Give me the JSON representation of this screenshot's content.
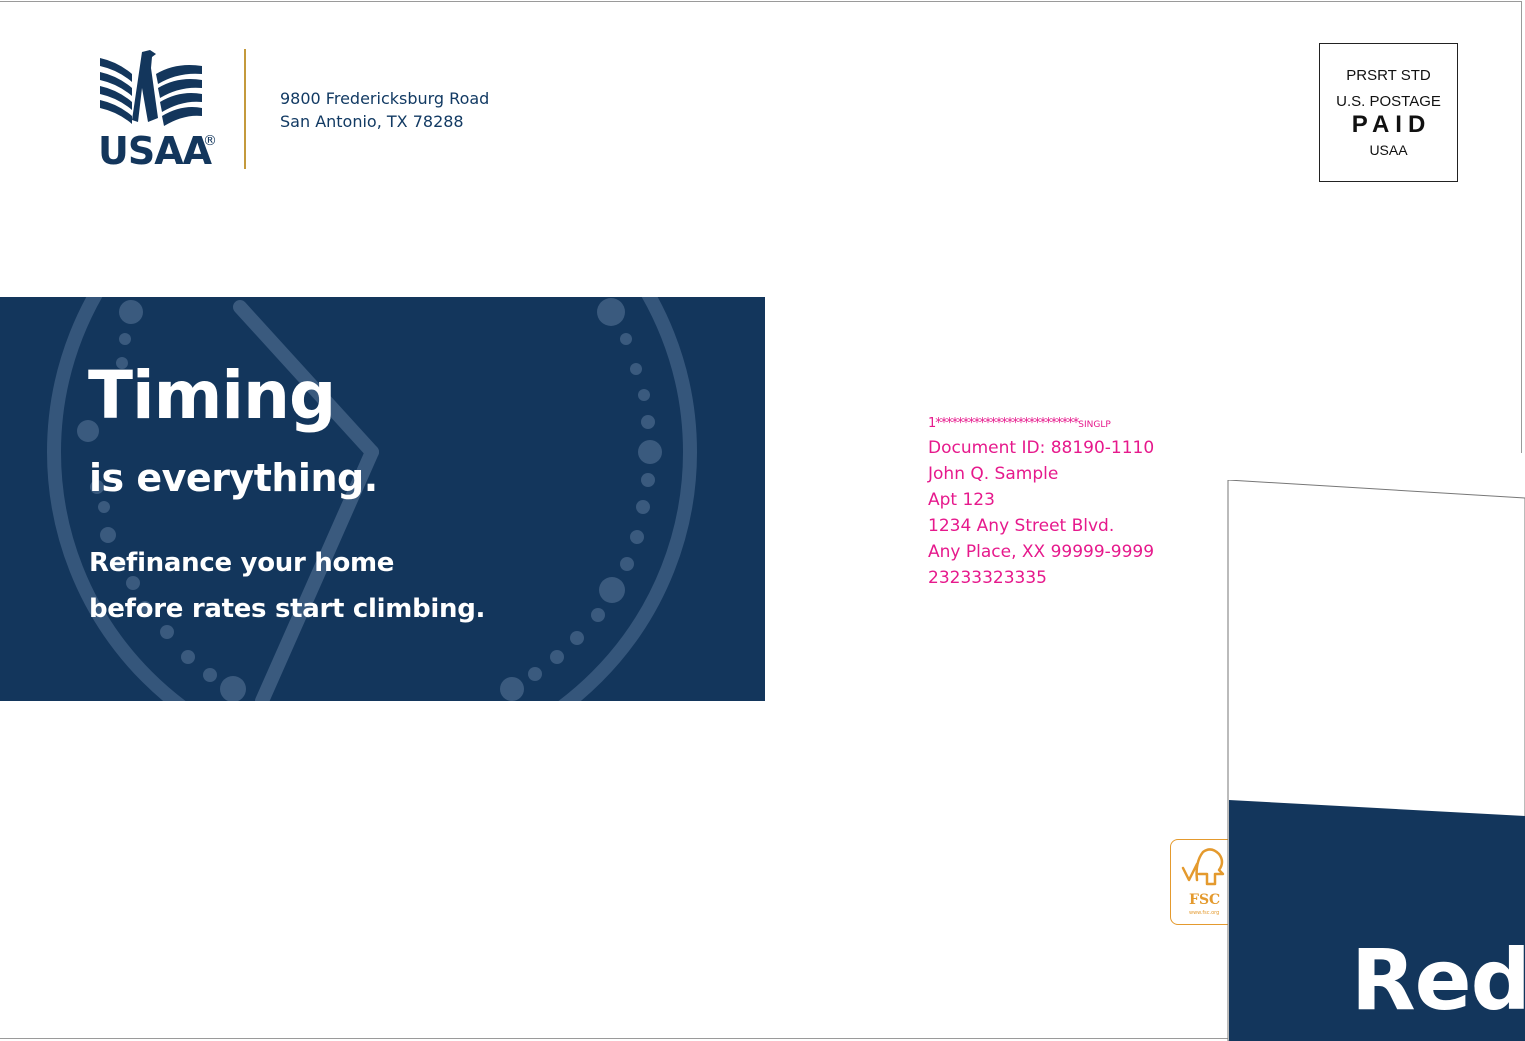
{
  "brand": {
    "name": "USAA",
    "registered_mark": "®",
    "navy": "#13365c",
    "gold": "#c49a3c",
    "address_pink": "#e6198c"
  },
  "return_address": {
    "line1": "9800 Fredericksburg Road",
    "line2": "San Antonio, TX 78288"
  },
  "postage": {
    "line1": "PRSRT STD",
    "line2": "U.S. POSTAGE",
    "line3": "PAID",
    "line4": "USAA"
  },
  "banner": {
    "headline": "Timing",
    "subhead": "is everything.",
    "body_line1": "Refinance your home",
    "body_line2": "before rates start climbing.",
    "background_icon": "clock-icon"
  },
  "mailing": {
    "barcode_line": "1**************************",
    "barcode_suffix": "SINGLP",
    "document_id": "Document ID: 88190-1110",
    "name": "John Q. Sample",
    "apt": "Apt 123",
    "street": "1234 Any Street Blvd.",
    "city": "Any Place, XX 99999-9999",
    "code": "23233323335"
  },
  "fsc": {
    "label": "FSC",
    "url": "www.fsc.org",
    "color": "#e49a2e"
  },
  "insert": {
    "headline_partial": "Redu"
  }
}
